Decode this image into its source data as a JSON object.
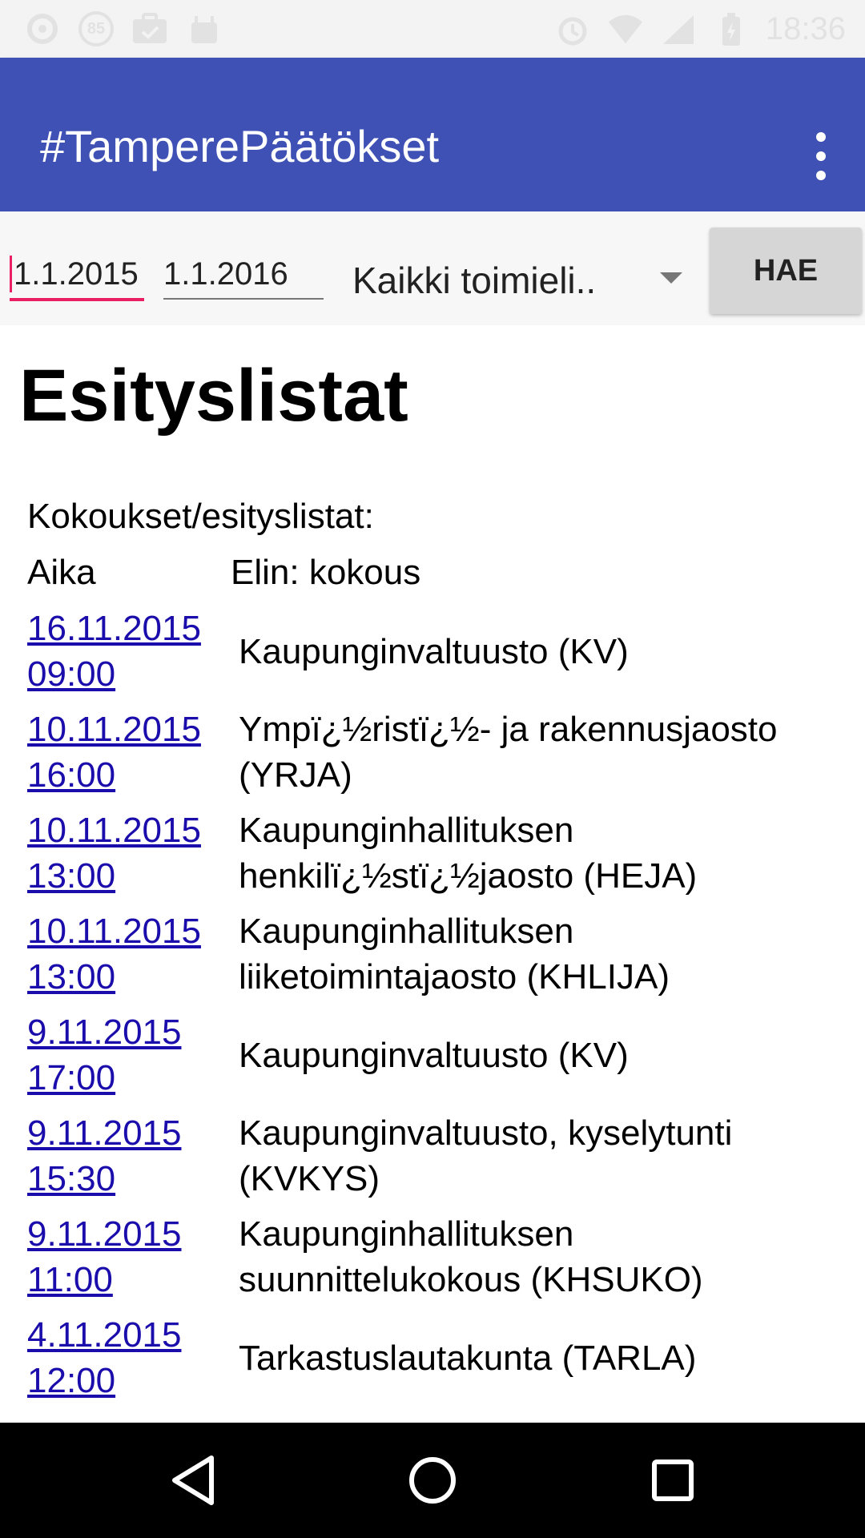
{
  "status_bar": {
    "time": "18:36",
    "badge": "85",
    "left_icons": [
      "sync-icon",
      "badge-icon",
      "briefcase-check-icon",
      "android-icon"
    ],
    "right_icons": [
      "alarm-icon",
      "wifi-icon",
      "signal-icon",
      "battery-charging-icon"
    ]
  },
  "app_bar": {
    "title": "#TamperePäätökset",
    "background": "#3f51b5",
    "overflow_icon": "more-vert-icon"
  },
  "filters": {
    "start_date": "1.1.2015",
    "end_date": "1.1.2016",
    "organ_selected": "Kaikki toimieli..",
    "search_button": "HAE"
  },
  "main": {
    "title": "Esityslistat",
    "caption": "Kokoukset/esityslistat:",
    "col_time": "Aika",
    "col_organ": "Elin: kokous",
    "rows": [
      {
        "date": "16.11.2015",
        "time": "09:00",
        "organ": "Kaupunginvaltuusto (KV)"
      },
      {
        "date": "10.11.2015",
        "time": "16:00",
        "organ": "Ympï¿½ristï¿½- ja rakennusjaosto (YRJA)"
      },
      {
        "date": "10.11.2015",
        "time": "13:00",
        "organ": "Kaupunginhallituksen henkilï¿½stï¿½jaosto (HEJA)"
      },
      {
        "date": "10.11.2015",
        "time": "13:00",
        "organ": "Kaupunginhallituksen liiketoimintajaosto (KHLIJA)"
      },
      {
        "date": "9.11.2015",
        "time": "17:00",
        "organ": "Kaupunginvaltuusto (KV)"
      },
      {
        "date": "9.11.2015",
        "time": "15:30",
        "organ": "Kaupunginvaltuusto, kyselytunti (KVKYS)"
      },
      {
        "date": "9.11.2015",
        "time": "11:00",
        "organ": "Kaupunginhallituksen suunnittelukokous (KHSUKO)"
      },
      {
        "date": "4.11.2015",
        "time": "12:00",
        "organ": "Tarkastuslautakunta (TARLA)"
      }
    ],
    "link_color": "#1a0dab"
  },
  "nav_bar": {
    "back": "back-icon",
    "home": "home-icon",
    "recents": "recents-icon"
  }
}
